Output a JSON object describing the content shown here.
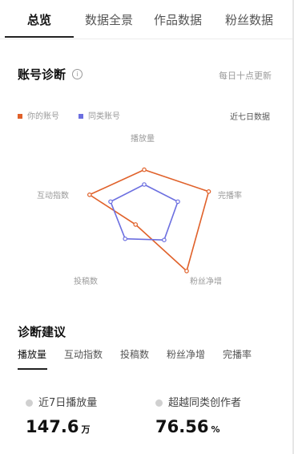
{
  "tabs": [
    "总览",
    "数据全景",
    "作品数据",
    "粉丝数据"
  ],
  "active_tab": "总览",
  "diagnosis": {
    "title": "账号诊断",
    "info_icon": "info-circle-icon",
    "update_note": "每日十点更新",
    "legend": [
      {
        "label": "你的账号",
        "color": "#e0612a"
      },
      {
        "label": "同类账号",
        "color": "#6c6fe0"
      }
    ],
    "range_label": "近七日数据"
  },
  "chart_data": {
    "type": "radar",
    "axes": [
      "播放量",
      "完播率",
      "粉丝净增",
      "投稿数",
      "互动指数"
    ],
    "series": [
      {
        "name": "你的账号",
        "color": "#e0612a",
        "values": [
          0.58,
          0.92,
          0.98,
          0.2,
          0.78
        ]
      },
      {
        "name": "同类账号",
        "color": "#6c6fe0",
        "values": [
          0.38,
          0.48,
          0.46,
          0.44,
          0.48
        ]
      }
    ],
    "range": [
      0,
      1
    ],
    "grid": false
  },
  "suggestions": {
    "title": "诊断建议",
    "tabs": [
      "播放量",
      "互动指数",
      "投稿数",
      "粉丝净增",
      "完播率"
    ],
    "active_tab": "播放量",
    "metrics": [
      {
        "label": "近7日播放量",
        "value": "147.6",
        "unit": "万"
      },
      {
        "label": "超越同类创作者",
        "value": "76.56",
        "unit": "%"
      }
    ]
  }
}
